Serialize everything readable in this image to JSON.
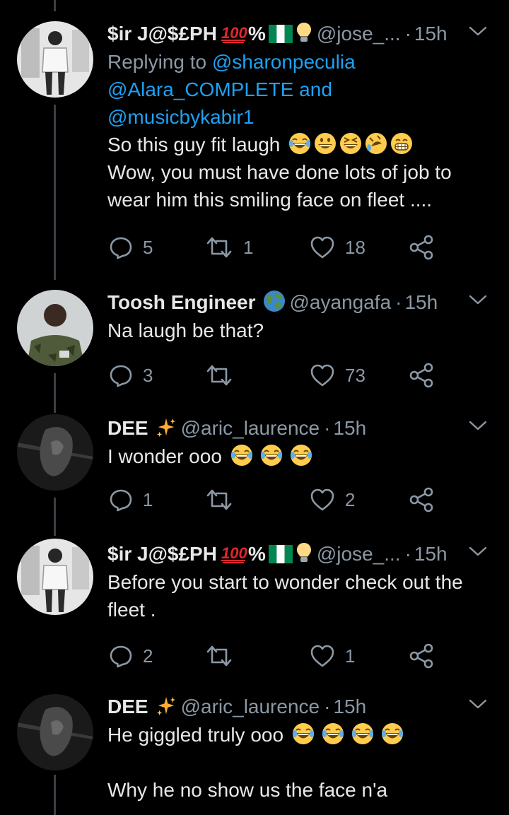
{
  "tweets": [
    {
      "name": "$ir J@$£PH",
      "name_extra": "%",
      "handle": "@jose_...",
      "time": "15h",
      "reply_prefix": "Replying to",
      "reply_to": [
        "@sharonpeculia",
        "@Alara_COMPLETE",
        "@musicbykabir1"
      ],
      "reply_and": "and",
      "text_line1": "So this guy fit laugh",
      "text_line2": "Wow, you must have done lots of job to",
      "text_line3": "wear him this smiling face on fleet ....",
      "replies": "5",
      "retweets": "1",
      "likes": "18"
    },
    {
      "name": "Toosh Engineer",
      "handle": "@ayangafa",
      "time": "15h",
      "text_line1": "Na laugh be that?",
      "replies": "3",
      "retweets": "",
      "likes": "73"
    },
    {
      "name": "DEE",
      "handle": "@aric_laurence",
      "time": "15h",
      "text_line1": "I wonder ooo",
      "replies": "1",
      "retweets": "",
      "likes": "2"
    },
    {
      "name": "$ir J@$£PH",
      "name_extra": "%",
      "handle": "@jose_...",
      "time": "15h",
      "text_line1": "Before you start to wonder check out the",
      "text_line2": "fleet .",
      "replies": "2",
      "retweets": "",
      "likes": "1"
    },
    {
      "name": "DEE",
      "handle": "@aric_laurence",
      "time": "15h",
      "text_line1": "He giggled truly ooo",
      "text_line3": "Why he no show us the face n'a"
    }
  ],
  "colors": {
    "background": "#000000",
    "link": "#1da1f2",
    "muted": "#8b98a5",
    "text": "#e8e8e8"
  },
  "icons": [
    "reply-icon",
    "retweet-icon",
    "like-icon",
    "share-icon",
    "caret-down-icon",
    "sparkles-icon",
    "globe-icon",
    "laughing-emoji-icon",
    "hundred-emoji-icon",
    "nigeria-flag-icon",
    "lightbulb-icon"
  ]
}
